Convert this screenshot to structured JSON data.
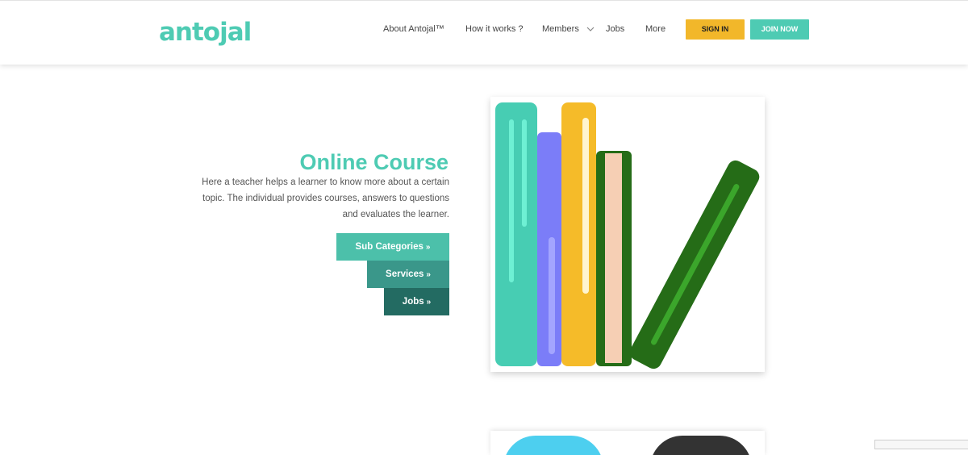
{
  "brand": {
    "logo_text": "antojal",
    "logo_color": "#4ecbb3"
  },
  "nav": {
    "items": [
      {
        "label": "About Antojal™"
      },
      {
        "label": "How it works ?"
      },
      {
        "label": "Members"
      },
      {
        "label": "Jobs"
      },
      {
        "label": "More"
      }
    ],
    "sign_in": "SIGN IN",
    "join_now": "JOIN NOW"
  },
  "hero": {
    "title": "Online Course",
    "description": "Here a teacher helps a learner to know more about a certain topic. The individual provides courses, answers to questions and evaluates the learner.",
    "buttons": [
      {
        "label": "Sub Categories",
        "icon": "double-chevron-right-icon"
      },
      {
        "label": "Services",
        "icon": "double-chevron-right-icon"
      },
      {
        "label": "Jobs",
        "icon": "double-chevron-right-icon"
      }
    ],
    "illustration": "books-icon"
  },
  "colors": {
    "accent_teal": "#4ecbb3",
    "signin_yellow": "#f2b72a",
    "join_teal": "#4ecbb3",
    "cta_1": "#4cc0aa",
    "cta_2": "#3a978a",
    "cta_3": "#236b62",
    "book_teal": "#47cdb3",
    "book_purple": "#7b7df8",
    "book_yellow": "#f5bb29",
    "book_green": "#256c17",
    "book_peach": "#f6cfb4"
  }
}
